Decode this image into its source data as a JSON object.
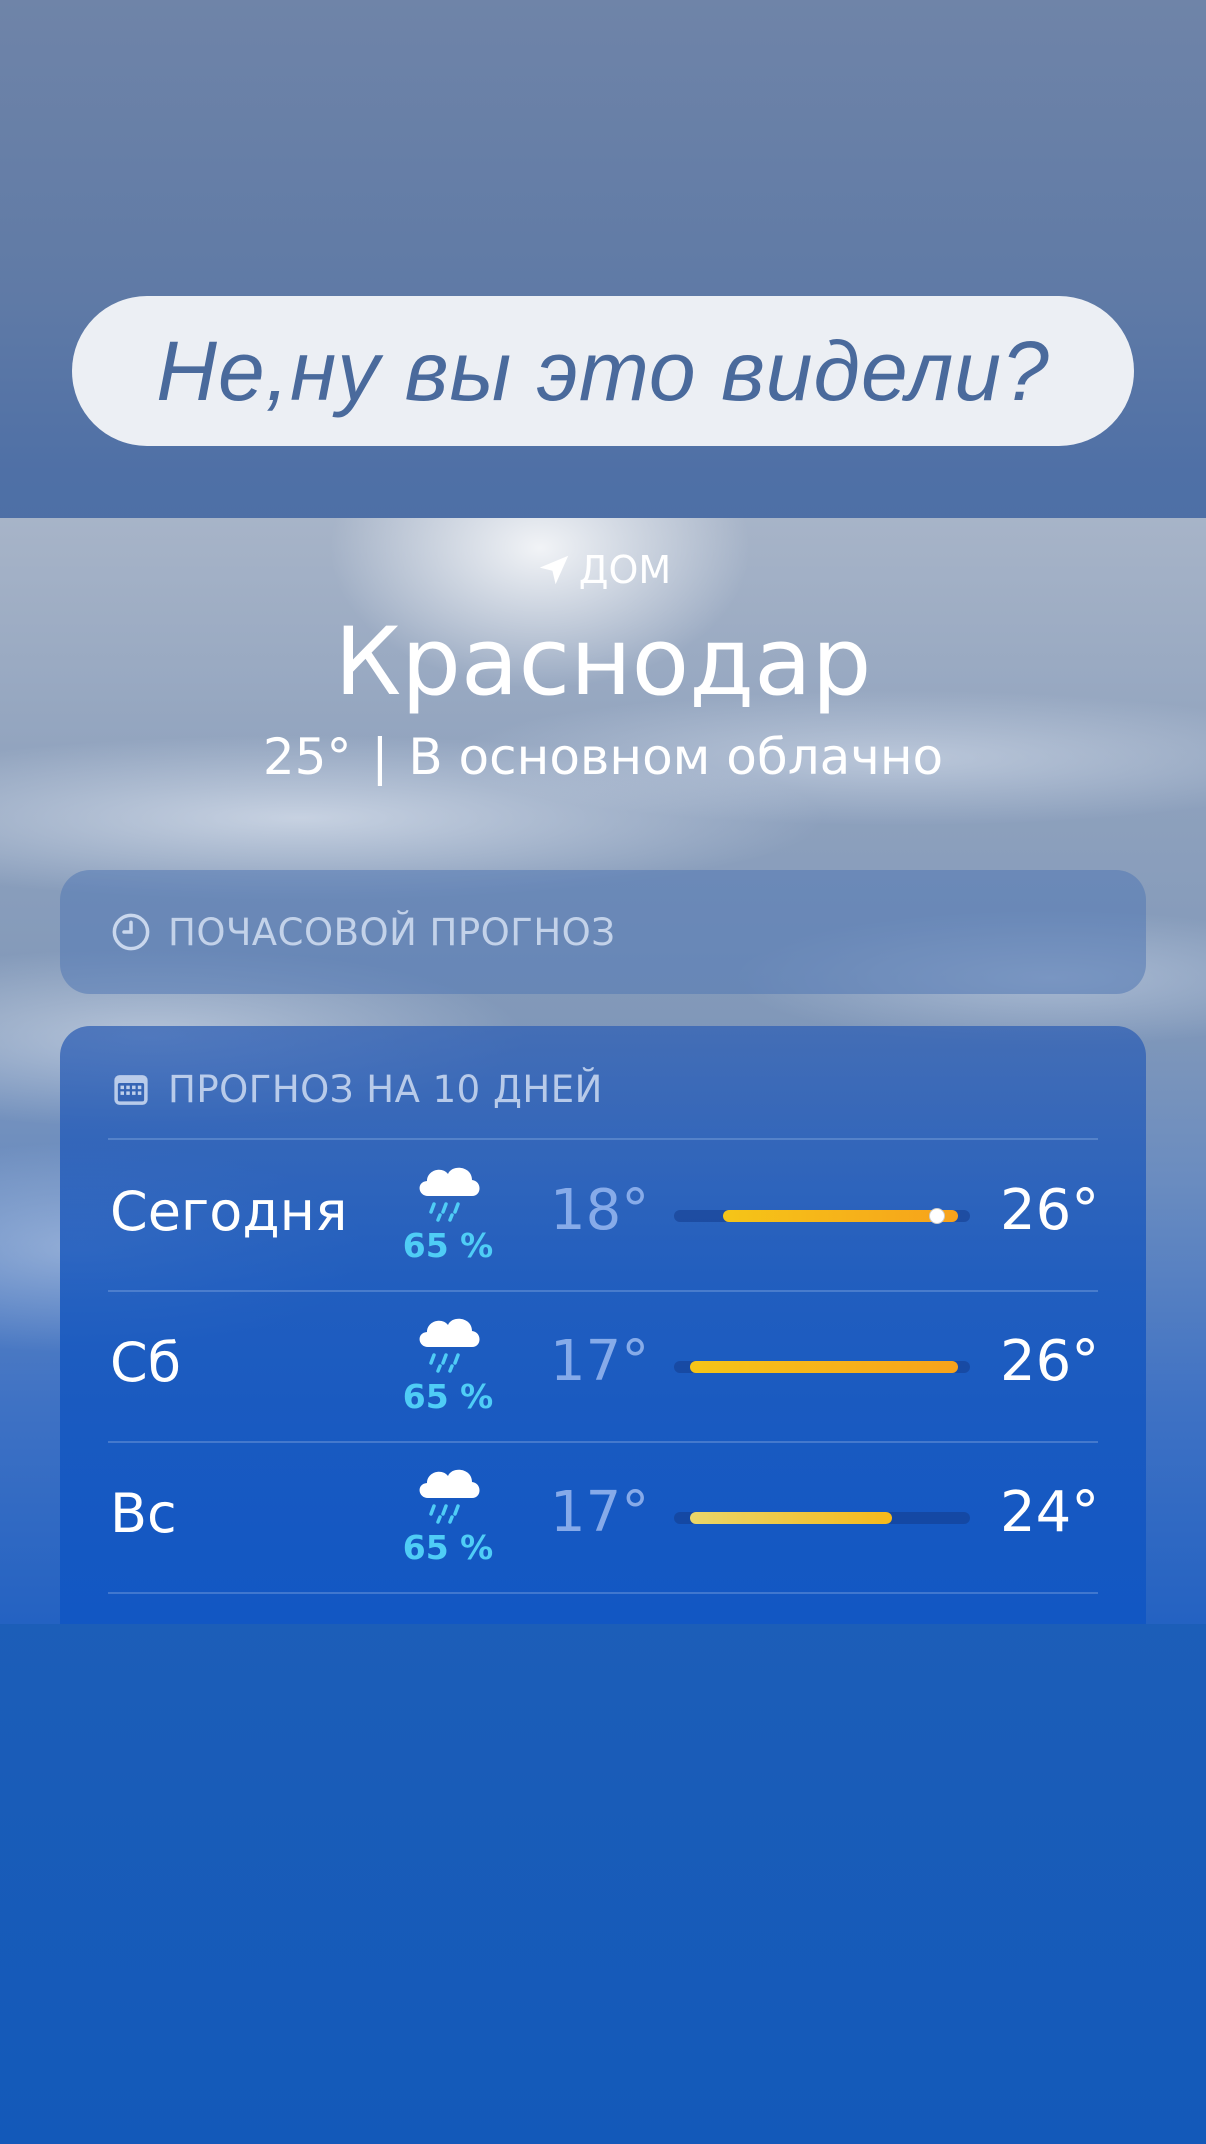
{
  "caption": "Не,ну вы это видели?",
  "location": {
    "label": "ДОМ",
    "city": "Краснодар",
    "current_temp": "25°",
    "condition": "В основном облачно"
  },
  "hourly": {
    "title": "ПОЧАСОВОЙ ПРОГНОЗ"
  },
  "daily": {
    "title": "ПРОГНОЗ НА 10 ДНЕЙ",
    "scale_min": 17,
    "scale_max": 26,
    "days": [
      {
        "name": "Сегодня",
        "icon": "cloud-rain-icon",
        "precip": "65 %",
        "low": "18°",
        "high": "26°",
        "low_val": 18,
        "high_val": 26,
        "current_val": 25,
        "colors": [
          "#f5c518",
          "#f7a21b"
        ]
      },
      {
        "name": "Сб",
        "icon": "cloud-rain-icon",
        "precip": "65 %",
        "low": "17°",
        "high": "26°",
        "low_val": 17,
        "high_val": 26,
        "current_val": null,
        "colors": [
          "#f5c518",
          "#f7a21b"
        ]
      },
      {
        "name": "Вс",
        "icon": "cloud-rain-icon",
        "precip": "65 %",
        "low": "17°",
        "high": "24°",
        "low_val": 17,
        "high_val": 24,
        "current_val": null,
        "colors": [
          "#e9d66a",
          "#f6b91a"
        ]
      }
    ]
  }
}
